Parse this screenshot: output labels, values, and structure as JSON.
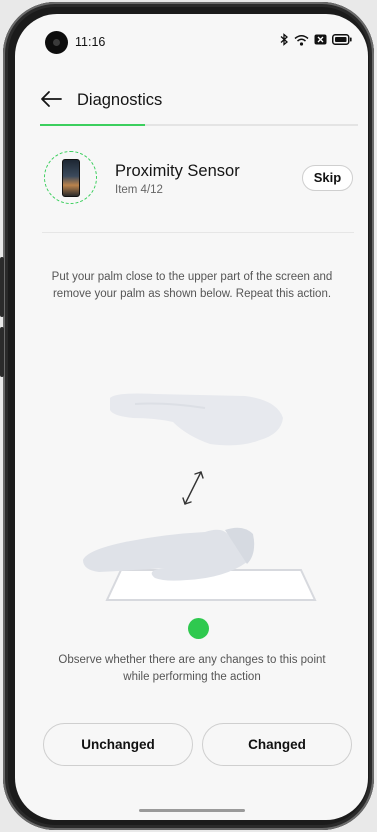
{
  "status_bar": {
    "time": "11:16",
    "icons": [
      "bluetooth-icon",
      "wifi-icon",
      "sim-icon",
      "battery-icon"
    ]
  },
  "header": {
    "title": "Diagnostics",
    "progress": 0.33
  },
  "item": {
    "name": "Proximity Sensor",
    "count": "Item 4/12",
    "skip_label": "Skip"
  },
  "instruction": "Put your palm close to the upper part of the screen and remove your palm as shown below. Repeat this action.",
  "observe_text": "Observe whether there are any changes to this point while performing the action",
  "indicator_color": "#2fc94f",
  "accent_color": "#3ccf5e",
  "actions": {
    "unchanged_label": "Unchanged",
    "changed_label": "Changed"
  }
}
